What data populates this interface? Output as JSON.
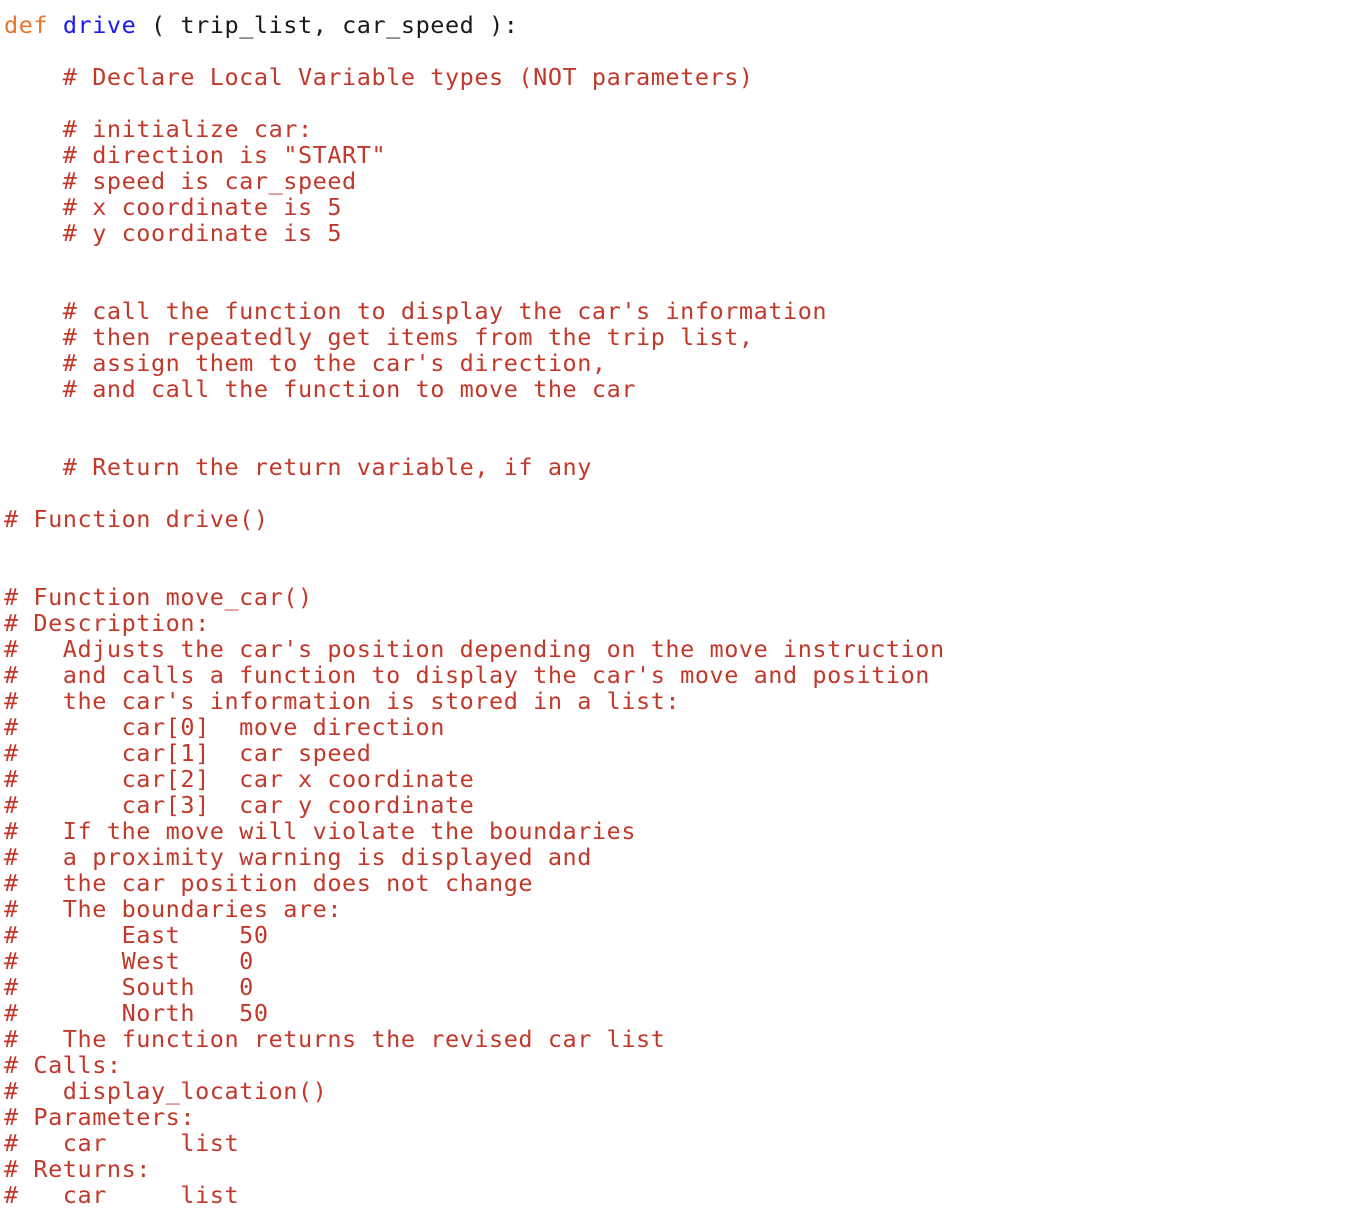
{
  "editor": {
    "language": "python",
    "background_color": "#ffffff",
    "colors": {
      "keyword": "#E8762C",
      "function_name": "#1818F0",
      "comment": "#C0392B",
      "plain_text": "#1a1a1a"
    }
  },
  "signature": {
    "keyword": "def",
    "space_after_keyword": " ",
    "function_name": "drive",
    "params_and_colon": " ( trip_list, car_speed ):"
  },
  "lines": [
    {
      "id": "l01",
      "type": "code",
      "text": ""
    },
    {
      "id": "l02",
      "type": "blank",
      "text": ""
    },
    {
      "id": "l03",
      "type": "comment",
      "text": "    # Declare Local Variable types (NOT parameters)"
    },
    {
      "id": "l04",
      "type": "blank",
      "text": ""
    },
    {
      "id": "l05",
      "type": "comment",
      "text": "    # initialize car:"
    },
    {
      "id": "l06",
      "type": "comment",
      "text": "    # direction is \"START\""
    },
    {
      "id": "l07",
      "type": "comment",
      "text": "    # speed is car_speed"
    },
    {
      "id": "l08",
      "type": "comment",
      "text": "    # x coordinate is 5"
    },
    {
      "id": "l09",
      "type": "comment",
      "text": "    # y coordinate is 5"
    },
    {
      "id": "l10",
      "type": "blank",
      "text": ""
    },
    {
      "id": "l11",
      "type": "blank",
      "text": ""
    },
    {
      "id": "l12",
      "type": "comment",
      "text": "    # call the function to display the car's information"
    },
    {
      "id": "l13",
      "type": "comment",
      "text": "    # then repeatedly get items from the trip list,"
    },
    {
      "id": "l14",
      "type": "comment",
      "text": "    # assign them to the car's direction,"
    },
    {
      "id": "l15",
      "type": "comment",
      "text": "    # and call the function to move the car"
    },
    {
      "id": "l16",
      "type": "blank",
      "text": ""
    },
    {
      "id": "l17",
      "type": "blank",
      "text": ""
    },
    {
      "id": "l18",
      "type": "comment",
      "text": "    # Return the return variable, if any"
    },
    {
      "id": "l19",
      "type": "blank",
      "text": ""
    },
    {
      "id": "l20",
      "type": "comment",
      "text": "# Function drive()"
    },
    {
      "id": "l21",
      "type": "blank",
      "text": ""
    },
    {
      "id": "l22",
      "type": "blank",
      "text": ""
    },
    {
      "id": "l23",
      "type": "comment",
      "text": "# Function move_car()"
    },
    {
      "id": "l24",
      "type": "comment",
      "text": "# Description:"
    },
    {
      "id": "l25",
      "type": "comment",
      "text": "#   Adjusts the car's position depending on the move instruction"
    },
    {
      "id": "l26",
      "type": "comment",
      "text": "#   and calls a function to display the car's move and position"
    },
    {
      "id": "l27",
      "type": "comment",
      "text": "#   the car's information is stored in a list:"
    },
    {
      "id": "l28",
      "type": "comment",
      "text": "#       car[0]  move direction"
    },
    {
      "id": "l29",
      "type": "comment",
      "text": "#       car[1]  car speed"
    },
    {
      "id": "l30",
      "type": "comment",
      "text": "#       car[2]  car x coordinate"
    },
    {
      "id": "l31",
      "type": "comment",
      "text": "#       car[3]  car y coordinate"
    },
    {
      "id": "l32",
      "type": "comment",
      "text": "#   If the move will violate the boundaries"
    },
    {
      "id": "l33",
      "type": "comment",
      "text": "#   a proximity warning is displayed and"
    },
    {
      "id": "l34",
      "type": "comment",
      "text": "#   the car position does not change"
    },
    {
      "id": "l35",
      "type": "comment",
      "text": "#   The boundaries are:"
    },
    {
      "id": "l36",
      "type": "comment",
      "text": "#       East    50"
    },
    {
      "id": "l37",
      "type": "comment",
      "text": "#       West    0"
    },
    {
      "id": "l38",
      "type": "comment",
      "text": "#       South   0"
    },
    {
      "id": "l39",
      "type": "comment",
      "text": "#       North   50"
    },
    {
      "id": "l40",
      "type": "comment",
      "text": "#   The function returns the revised car list"
    },
    {
      "id": "l41",
      "type": "comment",
      "text": "# Calls:"
    },
    {
      "id": "l42",
      "type": "comment",
      "text": "#   display_location()"
    },
    {
      "id": "l43",
      "type": "comment",
      "text": "# Parameters:"
    },
    {
      "id": "l44",
      "type": "comment",
      "text": "#   car     list"
    },
    {
      "id": "l45",
      "type": "comment",
      "text": "# Returns:"
    },
    {
      "id": "l46",
      "type": "comment",
      "text": "#   car     list"
    }
  ]
}
